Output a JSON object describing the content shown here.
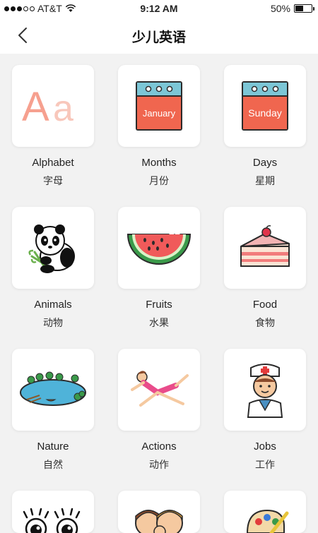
{
  "status": {
    "carrier": "AT&T",
    "time": "9:12 AM",
    "battery_pct": "50%"
  },
  "header": {
    "title": "少儿英语"
  },
  "categories": [
    {
      "en": "Alphabet",
      "cn": "字母",
      "icon": "alphabet-icon",
      "art": "Aa"
    },
    {
      "en": "Months",
      "cn": "月份",
      "icon": "calendar-months-icon",
      "art": "January"
    },
    {
      "en": "Days",
      "cn": "星期",
      "icon": "calendar-days-icon",
      "art": "Sunday"
    },
    {
      "en": "Animals",
      "cn": "动物",
      "icon": "panda-icon"
    },
    {
      "en": "Fruits",
      "cn": "水果",
      "icon": "watermelon-icon"
    },
    {
      "en": "Food",
      "cn": "食物",
      "icon": "cake-icon"
    },
    {
      "en": "Nature",
      "cn": "自然",
      "icon": "lake-icon"
    },
    {
      "en": "Actions",
      "cn": "动作",
      "icon": "gymnast-icon"
    },
    {
      "en": "Jobs",
      "cn": "工作",
      "icon": "nurse-icon"
    },
    {
      "en": "",
      "cn": "",
      "icon": "eyes-icon"
    },
    {
      "en": "",
      "cn": "",
      "icon": "family-icon"
    },
    {
      "en": "",
      "cn": "",
      "icon": "palette-icon"
    }
  ]
}
